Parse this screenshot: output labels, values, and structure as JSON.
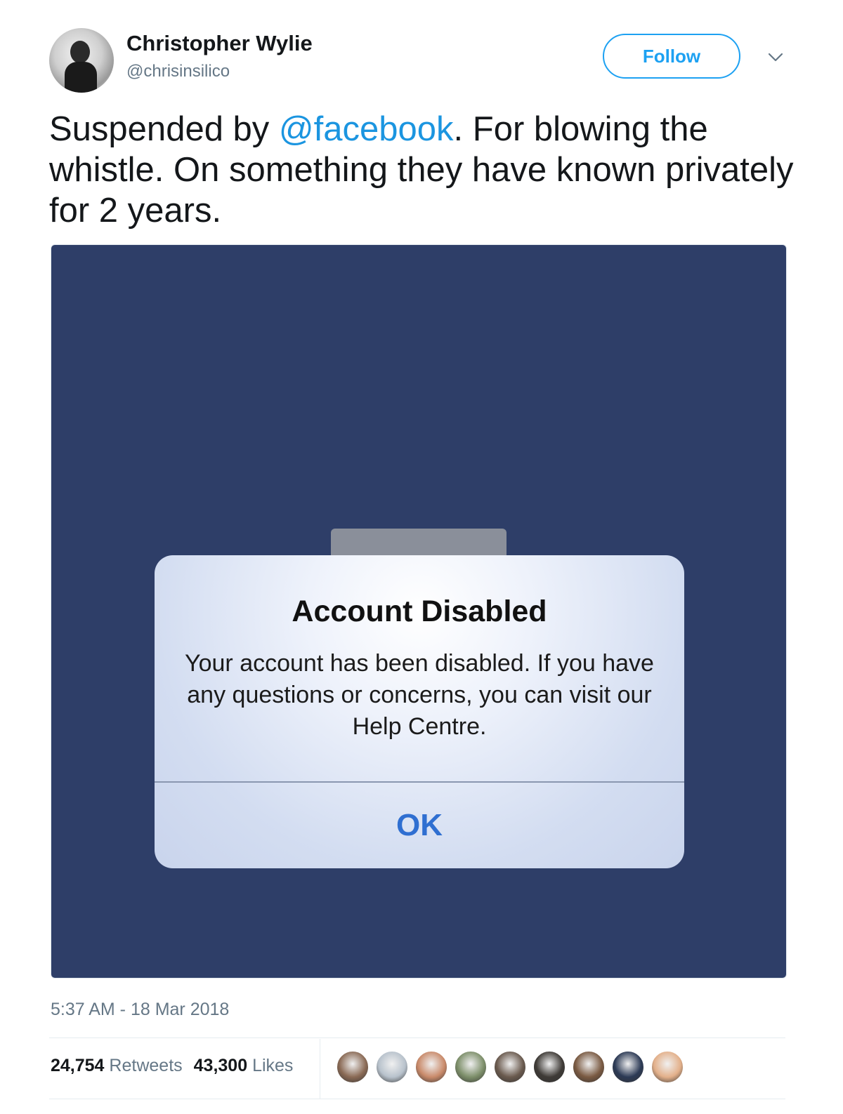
{
  "author": {
    "name": "Christopher Wylie",
    "handle": "@chrisinsilico",
    "follow_label": "Follow"
  },
  "tweet": {
    "text_before": "Suspended by ",
    "mention": "@facebook",
    "text_after": ". For blowing the whistle. On something they have known privately for 2 years."
  },
  "dialog": {
    "title": "Account Disabled",
    "body": "Your account has been disabled. If you have any questions or concerns, you can visit our Help Centre.",
    "ok_label": "OK"
  },
  "meta": {
    "timestamp": "5:37 AM - 18 Mar 2018",
    "retweets_count": "24,754",
    "retweets_label": "Retweets",
    "likes_count": "43,300",
    "likes_label": "Likes"
  },
  "colors": {
    "brand_blue": "#1da1f2",
    "mention_blue": "#1b95e0",
    "media_background": "#2e3e68",
    "dialog_ok": "#2f6fd1"
  },
  "likers": [
    {
      "color": "#8a6a55"
    },
    {
      "color": "#b8c2cc"
    },
    {
      "color": "#c98a6a"
    },
    {
      "color": "#7d8f6a"
    },
    {
      "color": "#6a5a4e"
    },
    {
      "color": "#3e3a36"
    },
    {
      "color": "#7a5a42"
    },
    {
      "color": "#2c3a55"
    },
    {
      "color": "#e3b08a"
    }
  ]
}
